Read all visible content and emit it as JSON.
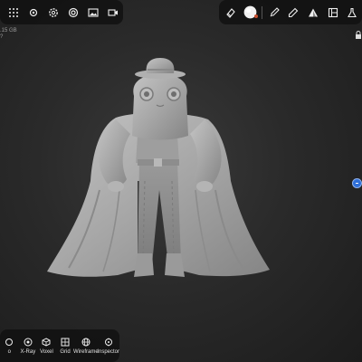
{
  "top_left_toolbar": {
    "icons": [
      "grid-icon",
      "sun-icon",
      "settings-icon",
      "target-icon",
      "image-icon",
      "video-icon"
    ]
  },
  "top_right_toolbar": {
    "icons": [
      "eraser-icon",
      "material-sphere-icon",
      "brush-icon",
      "eyedropper-icon",
      "triangle-icon",
      "layers-icon",
      "flask-icon"
    ]
  },
  "status": {
    "memory": ".15 GB",
    "memory_sub": "?"
  },
  "bottom_toolbar": {
    "items": [
      {
        "label": "o",
        "icon": "partial-icon"
      },
      {
        "label": "X-Ray",
        "icon": "xray-icon"
      },
      {
        "label": "Voxel",
        "icon": "voxel-icon"
      },
      {
        "label": "Grid",
        "icon": "grid-icon"
      },
      {
        "label": "Wireframe",
        "icon": "wireframe-icon"
      },
      {
        "label": "Inspector",
        "icon": "inspector-icon"
      }
    ]
  },
  "colors": {
    "background": "#2a2a2a",
    "model": "#a8a8a8",
    "accent": "#2f6fd8",
    "panel": "#121212"
  }
}
